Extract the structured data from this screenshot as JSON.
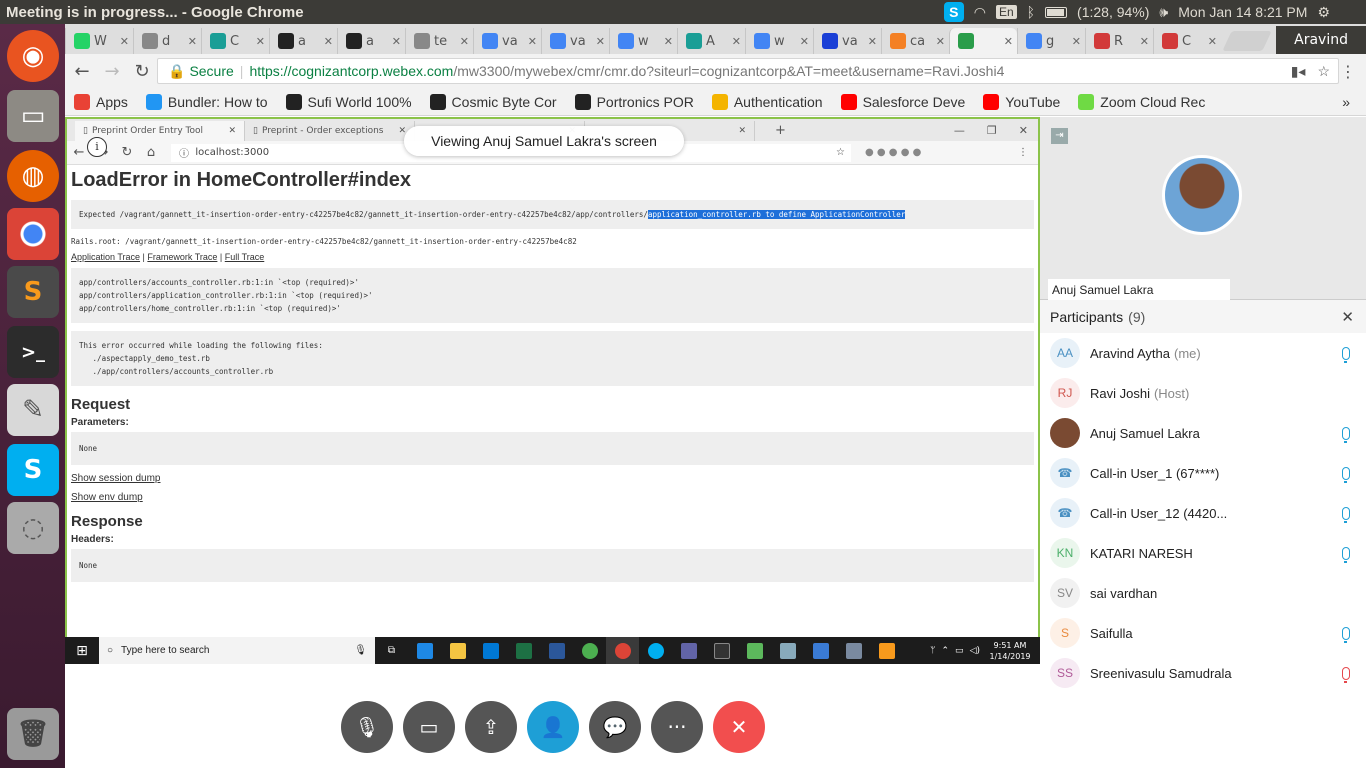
{
  "os_bar": {
    "window_title": "Meeting is in progress... - Google Chrome",
    "keyboard_layout": "En",
    "battery": "(1:28, 94%)",
    "datetime": "Mon Jan 14  8:21 PM"
  },
  "browser": {
    "tabs": [
      {
        "label": "W",
        "icon": "whatsapp-icon",
        "color": "#25d366"
      },
      {
        "label": "d",
        "icon": "doc-icon",
        "color": "#888888"
      },
      {
        "label": "C",
        "icon": "codepen-icon",
        "color": "#1a9e96"
      },
      {
        "label": "a",
        "icon": "github-icon",
        "color": "#222222"
      },
      {
        "label": "a",
        "icon": "github-icon",
        "color": "#222222"
      },
      {
        "label": "te",
        "icon": "doc-icon",
        "color": "#888888"
      },
      {
        "label": "va",
        "icon": "google-icon",
        "color": "#4285f4"
      },
      {
        "label": "va",
        "icon": "google-icon",
        "color": "#4285f4"
      },
      {
        "label": "w",
        "icon": "google-icon",
        "color": "#4285f4"
      },
      {
        "label": "A",
        "icon": "app-icon",
        "color": "#1a9e96"
      },
      {
        "label": "w",
        "icon": "google-icon",
        "color": "#4285f4"
      },
      {
        "label": "va",
        "icon": "vimeo-icon",
        "color": "#1a3fd6"
      },
      {
        "label": "ca",
        "icon": "stackoverflow-icon",
        "color": "#f48024"
      },
      {
        "label": "",
        "icon": "webex-icon",
        "color": "#2a9d4a",
        "active": true
      },
      {
        "label": "g",
        "icon": "google-icon",
        "color": "#4285f4"
      },
      {
        "label": "R",
        "icon": "shield-icon",
        "color": "#d23a3a"
      },
      {
        "label": "C",
        "icon": "shield-icon",
        "color": "#d23a3a"
      }
    ],
    "profile_name": "Aravind",
    "url_secure": "Secure",
    "url_host": "https://cognizantcorp.webex.com",
    "url_path": "/mw3300/mywebex/cmr/cmr.do?siteurl=cognizantcorp&AT=meet&username=Ravi.Joshi4",
    "bookmarks": [
      {
        "label": "Apps",
        "icon": "apps-grid-icon",
        "color": "#e94235"
      },
      {
        "label": "Bundler: How to",
        "icon": "bundler-icon",
        "color": "#2196f3"
      },
      {
        "label": "Sufi World 100%",
        "icon": "amazon-icon",
        "color": "#222222"
      },
      {
        "label": "Cosmic Byte Cor",
        "icon": "amazon-icon",
        "color": "#222222"
      },
      {
        "label": "Portronics POR",
        "icon": "amazon-icon",
        "color": "#222222"
      },
      {
        "label": "Authentication",
        "icon": "sunburst-icon",
        "color": "#f4b400"
      },
      {
        "label": "Salesforce Deve",
        "icon": "youtube-icon",
        "color": "#ff0000"
      },
      {
        "label": "YouTube",
        "icon": "youtube-icon",
        "color": "#ff0000"
      },
      {
        "label": "Zoom Cloud Rec",
        "icon": "upwork-icon",
        "color": "#6fda44"
      }
    ],
    "bookmarks_more": "»"
  },
  "shared_screen": {
    "toast": "Viewing Anuj Samuel Lakra's screen",
    "tabs": [
      "Preprint Order Entry Tool",
      "Preprint - Order exceptions",
      "",
      ""
    ],
    "url": "localhost:3000",
    "error_title": "LoadError in HomeController#index",
    "error_expected_prefix": "Expected /vagrant/gannett_it-insertion-order-entry-c42257be4c82/gannett_it-insertion-order-entry-c42257be4c82/app/controllers/",
    "error_expected_highlight": "application_controller.rb to define ApplicationController",
    "rails_root": "Rails.root: /vagrant/gannett_it-insertion-order-entry-c42257be4c82/gannett_it-insertion-order-entry-c42257be4c82",
    "trace_links": [
      "Application Trace",
      "Framework Trace",
      "Full Trace"
    ],
    "trace_lines": [
      "app/controllers/accounts_controller.rb:1:in `<top (required)>'",
      "app/controllers/application_controller.rb:1:in `<top (required)>'",
      "app/controllers/home_controller.rb:1:in `<top (required)>'"
    ],
    "load_msg": "This error occurred while loading the following files:",
    "load_files": [
      "   ./aspectapply_demo_test.rb",
      "   ./app/controllers/accounts_controller.rb"
    ],
    "request_heading": "Request",
    "parameters_label": "Parameters:",
    "parameters_value": "None",
    "session_dump": "Show session dump",
    "env_dump": "Show env dump",
    "response_heading": "Response",
    "headers_label": "Headers:",
    "headers_value": "None",
    "taskbar_search": "Type here to search",
    "taskbar_time": "9:51 AM",
    "taskbar_date": "1/14/2019"
  },
  "video": {
    "presenter_name": "Anuj Samuel Lakra"
  },
  "participants": {
    "title": "Participants",
    "count": "(9)",
    "list": [
      {
        "initials": "AA",
        "name": "Aravind Aytha",
        "role": "(me)",
        "mic": "on",
        "bg": "#e8f1f8",
        "fg": "#4a90c2"
      },
      {
        "initials": "RJ",
        "name": "Ravi Joshi",
        "role": "(Host)",
        "mic": "none",
        "bg": "#fbecec",
        "fg": "#d0574f"
      },
      {
        "initials": "",
        "name": "Anuj Samuel Lakra",
        "role": "",
        "mic": "on",
        "bg": "#7a4a32",
        "fg": "#ffffff"
      },
      {
        "initials": "☎",
        "name": "Call-in User_1 (67****)",
        "role": "",
        "mic": "on",
        "bg": "#e8f1f8",
        "fg": "#4a90c2"
      },
      {
        "initials": "☎",
        "name": "Call-in User_12 (4420...",
        "role": "",
        "mic": "on",
        "bg": "#e8f1f8",
        "fg": "#4a90c2"
      },
      {
        "initials": "KN",
        "name": "KATARI NARESH",
        "role": "",
        "mic": "on",
        "bg": "#eaf6ec",
        "fg": "#4caf6a"
      },
      {
        "initials": "SV",
        "name": "sai vardhan",
        "role": "",
        "mic": "none",
        "bg": "#f1f1f1",
        "fg": "#888888"
      },
      {
        "initials": "S",
        "name": "Saifulla",
        "role": "",
        "mic": "on",
        "bg": "#fdf0e6",
        "fg": "#e98a3d"
      },
      {
        "initials": "SS",
        "name": "Sreenivasulu Samudrala",
        "role": "",
        "mic": "muted",
        "bg": "#f6eaf3",
        "fg": "#b05a98"
      }
    ]
  },
  "controls": {
    "more_label": "···"
  }
}
